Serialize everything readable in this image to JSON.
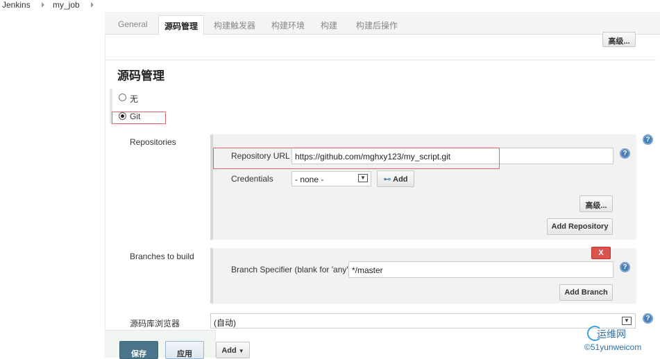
{
  "breadcrumb": {
    "root": "Jenkins",
    "job": "my_job"
  },
  "tabs": [
    "General",
    "源码管理",
    "构建触发器",
    "构建环境",
    "构建",
    "构建后操作"
  ],
  "advanced_label": "高级...",
  "section_title": "源码管理",
  "scm_options": {
    "none": "无",
    "git": "Git"
  },
  "repositories": {
    "label": "Repositories",
    "url_label": "Repository URL",
    "url_value": "https://github.com/mghxy123/my_script.git",
    "credentials_label": "Credentials",
    "credentials_value": "- none -",
    "add_label": "Add",
    "advanced_label": "高级...",
    "add_repo_label": "Add Repository"
  },
  "branches": {
    "label": "Branches to build",
    "delete_label": "X",
    "specifier_label": "Branch Specifier (blank for 'any')",
    "specifier_value": "*/master",
    "add_branch_label": "Add Branch"
  },
  "browser": {
    "label": "源码库浏览器",
    "value": "(自动)"
  },
  "footer": {
    "save_label": "保存",
    "apply_label": "应用",
    "add_label": "Add"
  },
  "watermark": {
    "brand": "运维网",
    "site": "©51yunweicom"
  },
  "colors": {
    "help_icon": "#4a7fb6",
    "delete_button": "#d9534f",
    "save_button": "#4b758b",
    "highlight_box": "#e0646e"
  }
}
